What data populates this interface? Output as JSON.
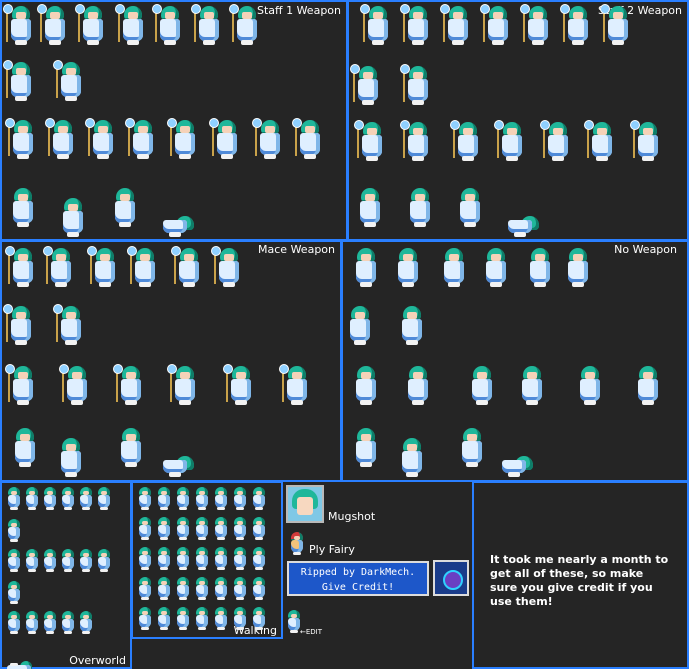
{
  "sheet": {
    "sections": {
      "staff1": {
        "label": "Staff 1 Weapon"
      },
      "staff2": {
        "label": "Staff 2 Weapon"
      },
      "mace": {
        "label": "Mace Weapon"
      },
      "noweapon": {
        "label": "No Weapon"
      },
      "overworld": {
        "label": "Overworld"
      },
      "walking": {
        "label": "Walking"
      }
    },
    "mugshot_label": "Mugshot",
    "ply_fairy_label": "Ply Fairy",
    "credit_line1": "Ripped by DarkMech.",
    "credit_line2": "Give Credit!",
    "edit_note": "←EDIT",
    "note": "It took me nearly a month to get all of these, so make sure you give credit if you use them!"
  },
  "colors": {
    "panel_border": "#2a7fff",
    "background": "#252525",
    "hair": "#1fb79a",
    "robe": "#dfefff",
    "credit_box": "#1d57c9"
  },
  "icons": [
    "mugshot-icon",
    "fairy-orb-icon",
    "sprite-figure-icon"
  ]
}
